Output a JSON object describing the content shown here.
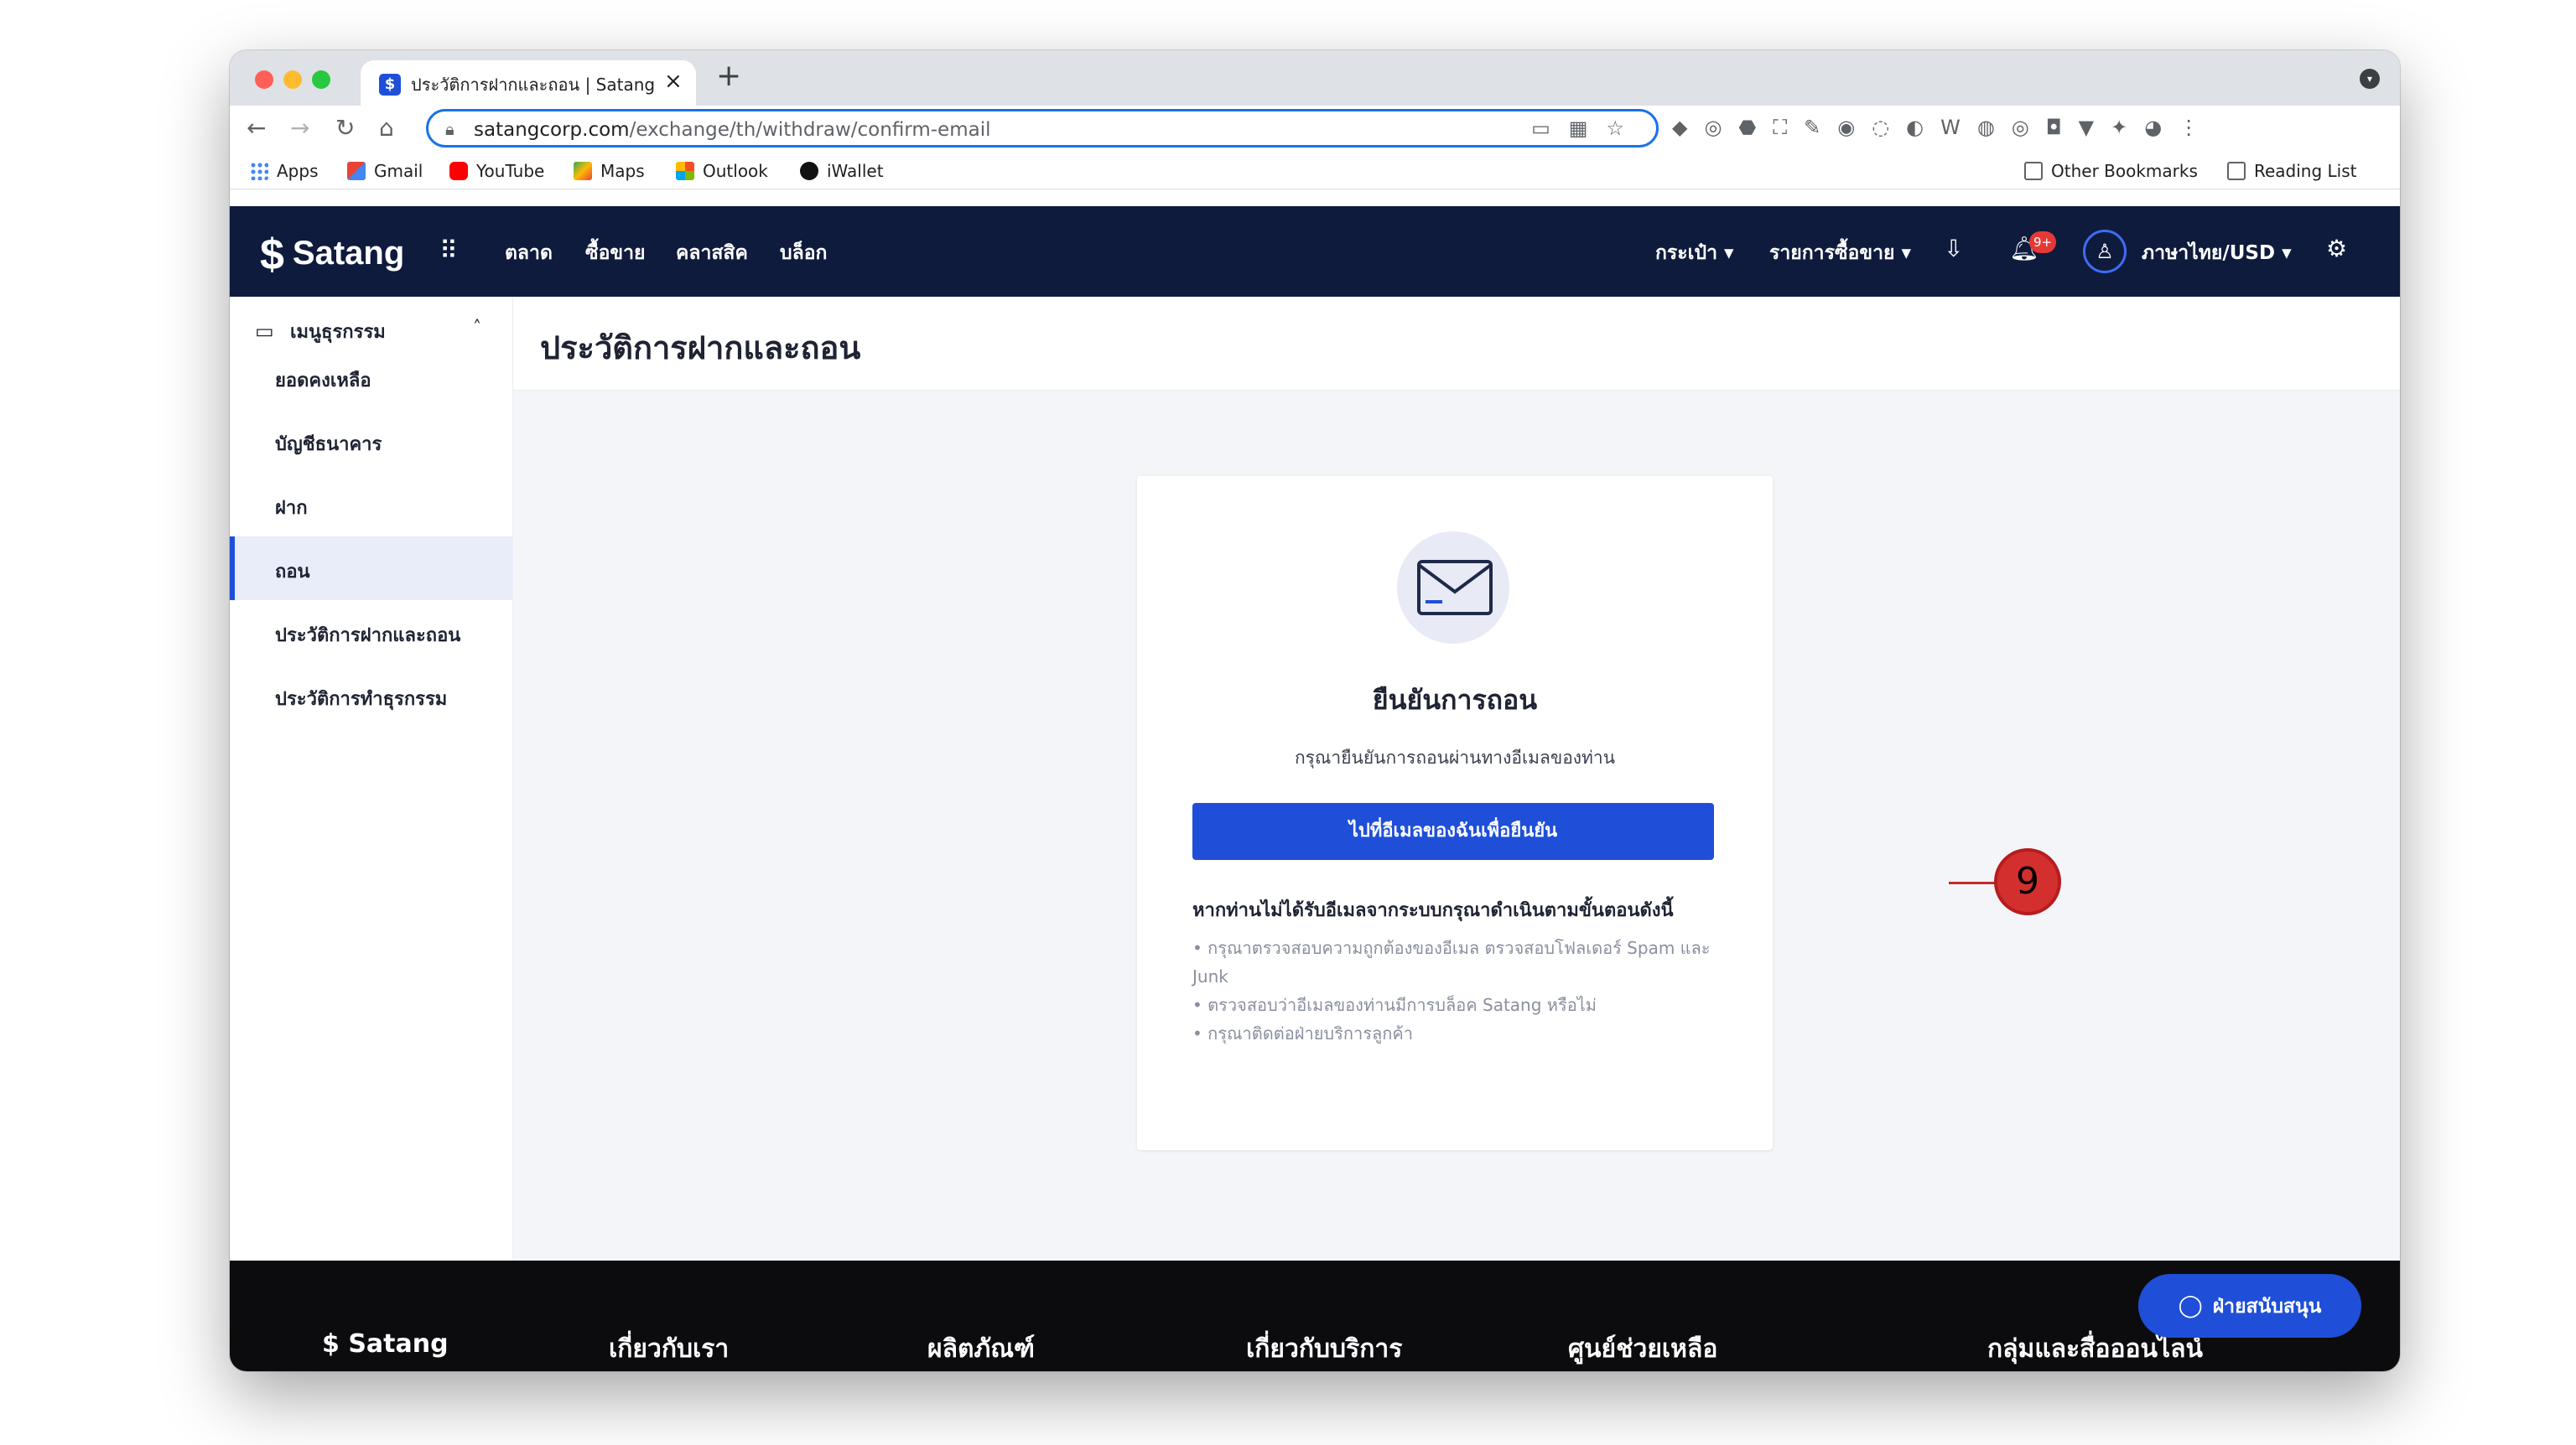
{
  "browser": {
    "tab_title": "ประวัติการฝากและถอน | Satangco",
    "url_domain": "satangcorp.com",
    "url_path": "/exchange/th/withdraw/confirm-email",
    "bookmarks": [
      "Apps",
      "Gmail",
      "YouTube",
      "Maps",
      "Outlook",
      "iWallet"
    ],
    "bookmarks_right": [
      "Other Bookmarks",
      "Reading List"
    ]
  },
  "site": {
    "logo": "Satang",
    "nav": [
      "ตลาด",
      "ซื้อขาย",
      "คลาสสิค",
      "บล็อก"
    ],
    "wallet_menu": "กระเป๋า ▾",
    "orders_menu": "รายการซื้อขาย ▾",
    "notif_badge": "9+",
    "language": "ภาษาไทย/USD ▾"
  },
  "sidebar": {
    "header": "เมนูธุรกรรม",
    "items": [
      {
        "label": "ยอดคงเหลือ"
      },
      {
        "label": "บัญชีธนาคาร"
      },
      {
        "label": "ฝาก"
      },
      {
        "label": "ถอน"
      },
      {
        "label": "ประวัติการฝากและถอน"
      },
      {
        "label": "ประวัติการทำธุรกรรม"
      }
    ]
  },
  "main": {
    "page_title": "ประวัติการฝากและถอน",
    "card_title": "ยืนยันการถอน",
    "card_desc": "กรุณายืนยันการถอนผ่านทางอีเมลของท่าน",
    "confirm_button": "ไปที่อีเมลของฉันเพื่อยืนยัน",
    "help_title": "หากท่านไม่ได้รับอีเมลจากระบบกรุณาดำเนินตามขั้นตอนดังนี้",
    "help_items": [
      "• กรุณาตรวจสอบความถูกต้องของอีเมล ตรวจสอบโฟลเดอร์ Spam และ Junk",
      "• ตรวจสอบว่าอีเมลของท่านมีการบล็อค Satang หรือไม่",
      "• กรุณาติดต่อฝ่ายบริการลูกค้า"
    ],
    "annotation": "9"
  },
  "footer": {
    "logo": "Satang",
    "columns": [
      "เกี่ยวกับเรา",
      "ผลิตภัณฑ์",
      "เกี่ยวกับบริการ",
      "ศูนย์ช่วยเหลือ",
      "กลุ่มและสื่อออนไลน์"
    ],
    "support_button": "ฝ่ายสนับสนุน"
  },
  "colors": {
    "header_bg": "#0f1b3d",
    "primary": "#1f4fd8",
    "annotation": "#d32f2f"
  }
}
